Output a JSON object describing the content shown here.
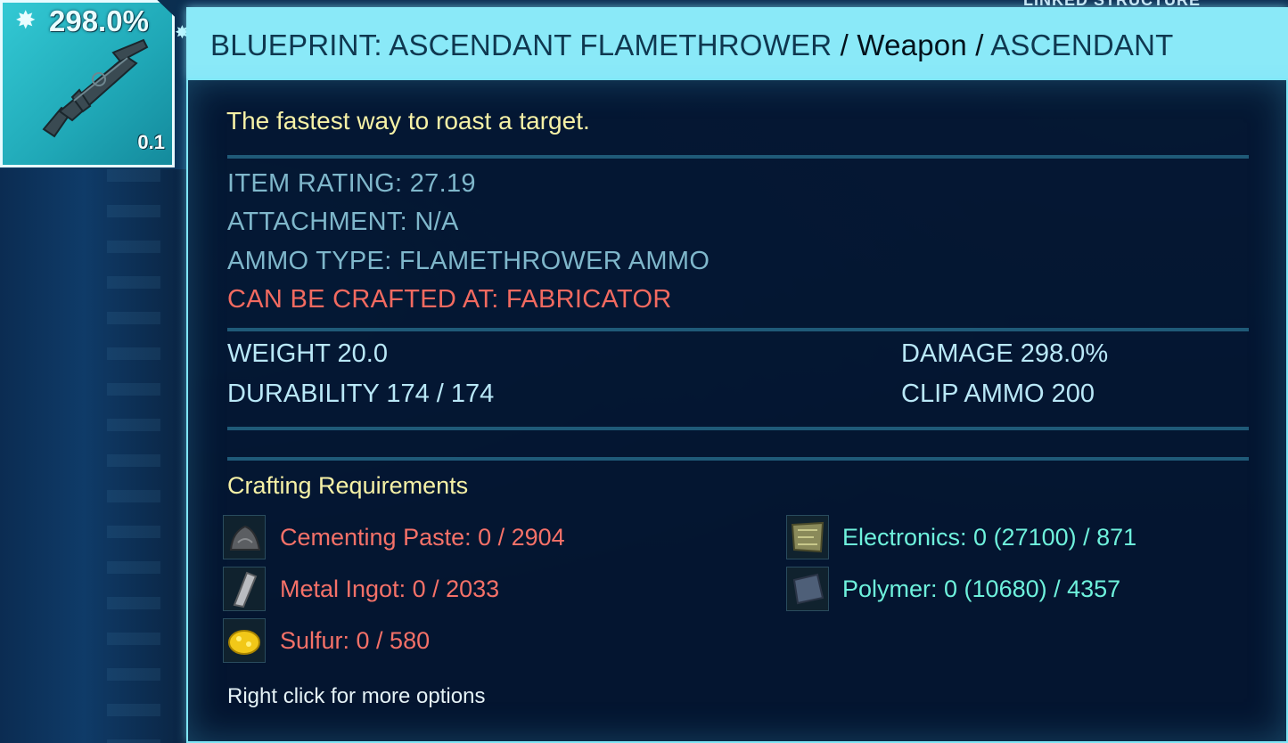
{
  "background": {
    "top_right_text": "LINKED STRUCTURE"
  },
  "slot": {
    "damage": "298.0%",
    "quantity": "0.1",
    "item_icon": "flamethrower-icon",
    "quality_icon": "sparkle-icon"
  },
  "header": {
    "name": "BLUEPRINT: ASCENDANT FLAMETHROWER",
    "sep1": " / ",
    "category": "Weapon",
    "sep2": " / ",
    "quality": "ASCENDANT"
  },
  "description": "The fastest way to roast a target.",
  "stats": {
    "item_rating": "ITEM RATING: 27.19",
    "attachment": "ATTACHMENT: N/A",
    "ammo_type": "AMMO TYPE: FLAMETHROWER AMMO",
    "crafted_at": "CAN BE CRAFTED AT: FABRICATOR",
    "weight": "WEIGHT 20.0",
    "durability": "DURABILITY 174 / 174",
    "damage": "DAMAGE 298.0%",
    "clip_ammo": "CLIP AMMO 200"
  },
  "crafting": {
    "heading": "Crafting Requirements",
    "left": [
      {
        "icon": "cementing-paste-icon",
        "label": "Cementing Paste: 0 / 2904"
      },
      {
        "icon": "metal-ingot-icon",
        "label": "Metal Ingot: 0 / 2033"
      },
      {
        "icon": "sulfur-icon",
        "label": "Sulfur: 0 / 580"
      }
    ],
    "right": [
      {
        "icon": "electronics-icon",
        "label": "Electronics: 0 (27100) / 871"
      },
      {
        "icon": "polymer-icon",
        "label": "Polymer: 0 (10680) / 4357"
      }
    ]
  },
  "hint": "Right click for more options",
  "colors": {
    "title_bar": "#8ae9f8",
    "description": "#f6f1a6",
    "missing": "#f57168",
    "available": "#6ef1dc"
  }
}
